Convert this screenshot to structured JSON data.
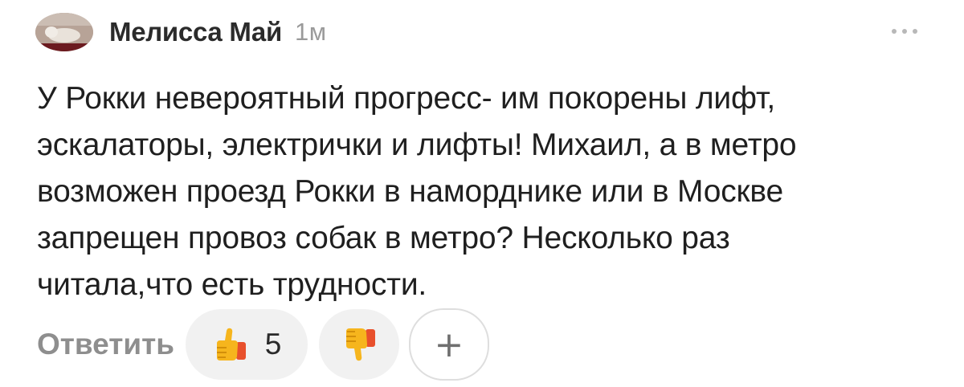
{
  "comment": {
    "author": "Мелисса Май",
    "time": "1м",
    "text": "У Рокки невероятный прогресс- им покорены лифт,\nэскалаторы, электрички и лифты! Михаил, а в метро\nвозможен проезд Рокки в наморднике или в Москве\nзапрещен провоз собак в метро? Несколько раз\nчитала,что есть трудности."
  },
  "actions": {
    "reply_label": "Ответить",
    "like_count": "5",
    "like_icon": "thumbs-up-icon",
    "dislike_icon": "thumbs-down-icon",
    "add_label": "+"
  },
  "colors": {
    "reaction_bg": "#f1f1f1",
    "muted_text": "#8e8e8e"
  }
}
